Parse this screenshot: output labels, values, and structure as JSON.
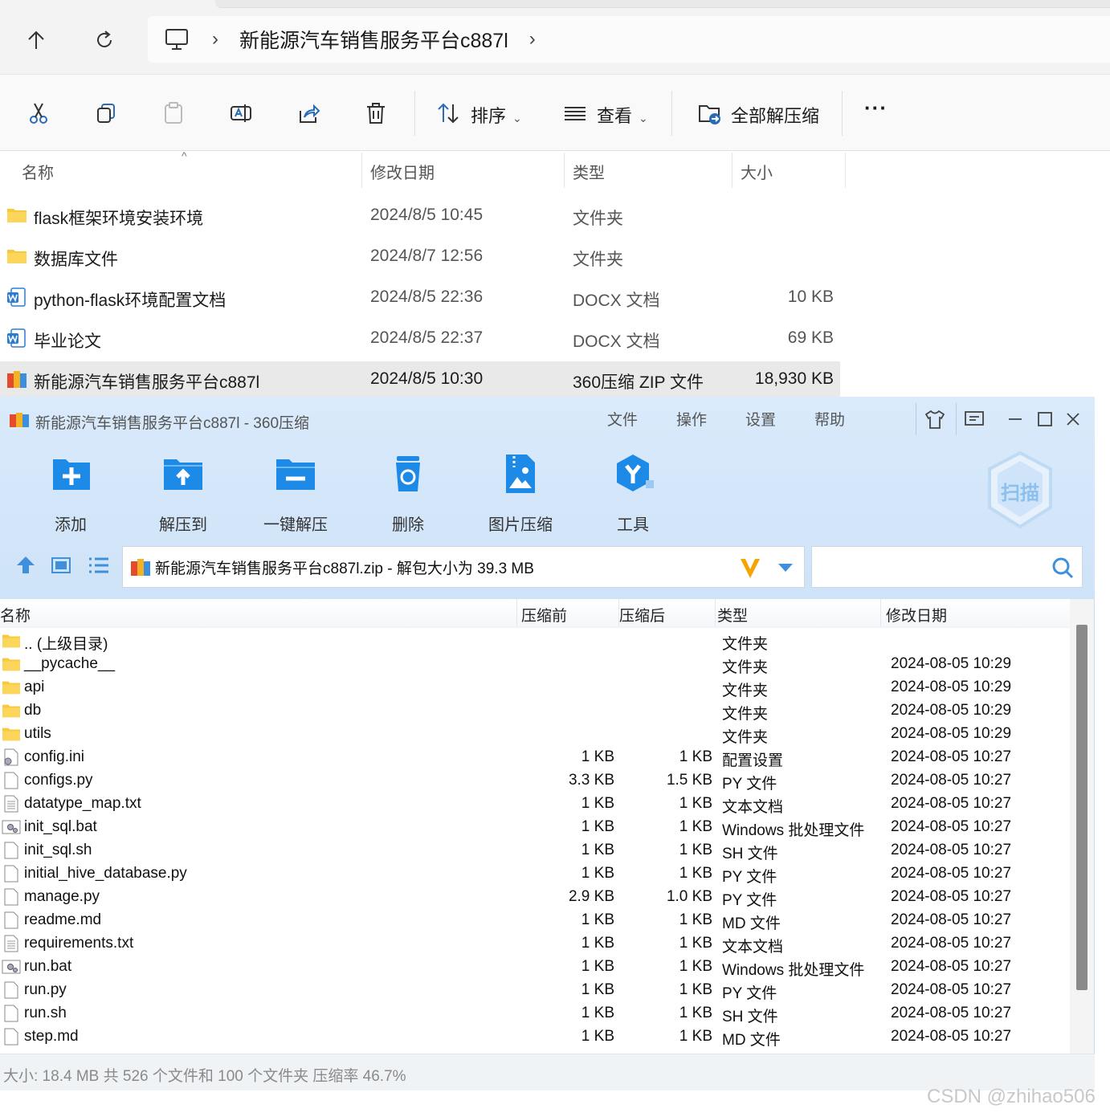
{
  "explorer": {
    "path_current": "新能源汽车销售服务平台c887l",
    "toolbar": {
      "sort_label": "排序",
      "view_label": "查看",
      "extract_all_label": "全部解压缩",
      "more_label": "···"
    },
    "columns": {
      "name": "名称",
      "modified": "修改日期",
      "type": "类型",
      "size": "大小"
    },
    "files": [
      {
        "icon": "folder-icon",
        "name": "flask框架环境安装环境",
        "date": "2024/8/5 10:45",
        "type": "文件夹",
        "size": ""
      },
      {
        "icon": "folder-icon",
        "name": "数据库文件",
        "date": "2024/8/7 12:56",
        "type": "文件夹",
        "size": ""
      },
      {
        "icon": "word-doc-icon",
        "name": "python-flask环境配置文档",
        "date": "2024/8/5 22:36",
        "type": "DOCX 文档",
        "size": "10 KB"
      },
      {
        "icon": "word-doc-icon",
        "name": "毕业论文",
        "date": "2024/8/5 22:37",
        "type": "DOCX 文档",
        "size": "69 KB"
      },
      {
        "icon": "zip-archive-icon",
        "name": "新能源汽车销售服务平台c887l",
        "date": "2024/8/5 10:30",
        "type": "360压缩 ZIP 文件",
        "size": "18,930 KB",
        "selected": true
      }
    ]
  },
  "zip": {
    "title": "新能源汽车销售服务平台c887l - 360压缩",
    "menu": [
      "文件",
      "操作",
      "设置",
      "帮助"
    ],
    "tools": [
      {
        "icon": "add-icon",
        "label": "添加"
      },
      {
        "icon": "extract-to-icon",
        "label": "解压到"
      },
      {
        "icon": "one-click-extract-icon",
        "label": "一键解压"
      },
      {
        "icon": "delete-icon",
        "label": "删除"
      },
      {
        "icon": "image-compress-icon",
        "label": "图片压缩"
      },
      {
        "icon": "tools-icon",
        "label": "工具"
      }
    ],
    "scan_label": "扫描",
    "path": "新能源汽车销售服务平台c887l.zip - 解包大小为 39.3 MB",
    "search_placeholder": "",
    "columns": {
      "name": "名称",
      "before": "压缩前",
      "after": "压缩后",
      "type": "类型",
      "modified": "修改日期"
    },
    "rows": [
      {
        "icon": "folder-icon",
        "name": ".. (上级目录)",
        "before": "",
        "after": "",
        "type": "文件夹",
        "date": ""
      },
      {
        "icon": "folder-icon",
        "name": "__pycache__",
        "before": "",
        "after": "",
        "type": "文件夹",
        "date": "2024-08-05 10:29"
      },
      {
        "icon": "folder-icon",
        "name": "api",
        "before": "",
        "after": "",
        "type": "文件夹",
        "date": "2024-08-05 10:29"
      },
      {
        "icon": "folder-icon",
        "name": "db",
        "before": "",
        "after": "",
        "type": "文件夹",
        "date": "2024-08-05 10:29"
      },
      {
        "icon": "folder-icon",
        "name": "utils",
        "before": "",
        "after": "",
        "type": "文件夹",
        "date": "2024-08-05 10:29"
      },
      {
        "icon": "settings-file-icon",
        "name": "config.ini",
        "before": "1 KB",
        "after": "1 KB",
        "type": "配置设置",
        "date": "2024-08-05 10:27"
      },
      {
        "icon": "blank-file-icon",
        "name": "configs.py",
        "before": "3.3 KB",
        "after": "1.5 KB",
        "type": "PY 文件",
        "date": "2024-08-05 10:27"
      },
      {
        "icon": "text-file-icon",
        "name": "datatype_map.txt",
        "before": "1 KB",
        "after": "1 KB",
        "type": "文本文档",
        "date": "2024-08-05 10:27"
      },
      {
        "icon": "batch-file-icon",
        "name": "init_sql.bat",
        "before": "1 KB",
        "after": "1 KB",
        "type": "Windows 批处理文件",
        "date": "2024-08-05 10:27"
      },
      {
        "icon": "blank-file-icon",
        "name": "init_sql.sh",
        "before": "1 KB",
        "after": "1 KB",
        "type": "SH 文件",
        "date": "2024-08-05 10:27"
      },
      {
        "icon": "blank-file-icon",
        "name": "initial_hive_database.py",
        "before": "1 KB",
        "after": "1 KB",
        "type": "PY 文件",
        "date": "2024-08-05 10:27"
      },
      {
        "icon": "blank-file-icon",
        "name": "manage.py",
        "before": "2.9 KB",
        "after": "1.0 KB",
        "type": "PY 文件",
        "date": "2024-08-05 10:27"
      },
      {
        "icon": "blank-file-icon",
        "name": "readme.md",
        "before": "1 KB",
        "after": "1 KB",
        "type": "MD 文件",
        "date": "2024-08-05 10:27"
      },
      {
        "icon": "text-file-icon",
        "name": "requirements.txt",
        "before": "1 KB",
        "after": "1 KB",
        "type": "文本文档",
        "date": "2024-08-05 10:27"
      },
      {
        "icon": "batch-file-icon",
        "name": "run.bat",
        "before": "1 KB",
        "after": "1 KB",
        "type": "Windows 批处理文件",
        "date": "2024-08-05 10:27"
      },
      {
        "icon": "blank-file-icon",
        "name": "run.py",
        "before": "1 KB",
        "after": "1 KB",
        "type": "PY 文件",
        "date": "2024-08-05 10:27"
      },
      {
        "icon": "blank-file-icon",
        "name": "run.sh",
        "before": "1 KB",
        "after": "1 KB",
        "type": "SH 文件",
        "date": "2024-08-05 10:27"
      },
      {
        "icon": "blank-file-icon",
        "name": "step.md",
        "before": "1 KB",
        "after": "1 KB",
        "type": "MD 文件",
        "date": "2024-08-05 10:27"
      }
    ],
    "status": "大小: 18.4 MB 共 526 个文件和 100 个文件夹 压缩率 46.7%"
  },
  "watermark": "CSDN @zhihao506",
  "colors": {
    "zip_header_bg": "#d9eafb",
    "zip_icon_blue": "#1e8ae8",
    "selected_row": "#e9e9e9",
    "folder_yellow": "#f8c93a"
  }
}
